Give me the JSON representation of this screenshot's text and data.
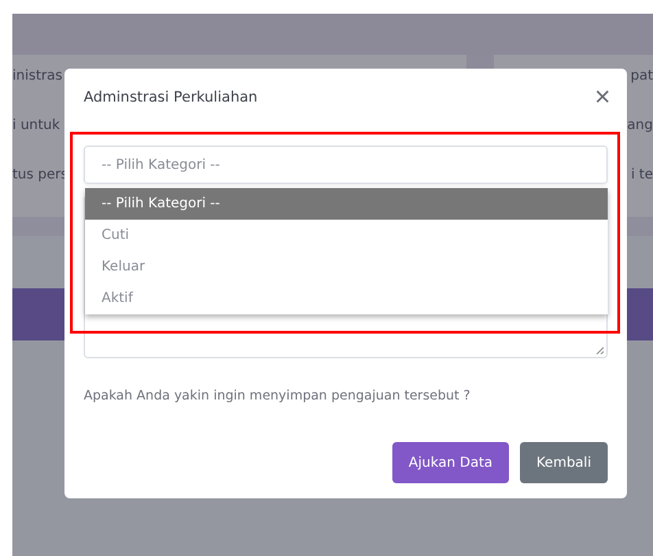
{
  "background": {
    "left_panel": [
      "inistras",
      "i untuk",
      "tus pers"
    ],
    "right_panel": [
      "pat",
      "ang",
      "i te"
    ]
  },
  "modal": {
    "title": "Adminstrasi Perkuliahan",
    "close": "×",
    "select": {
      "placeholder": "-- Pilih Kategori --",
      "expanded": true
    },
    "options": [
      {
        "label": "-- Pilih Kategori --",
        "selected": true
      },
      {
        "label": "Cuti",
        "selected": false
      },
      {
        "label": "Keluar",
        "selected": false
      },
      {
        "label": "Aktif",
        "selected": false
      }
    ],
    "message": "Apakah Anda yakin ingin menyimpan pengajuan tersebut ?",
    "buttons": [
      {
        "kind": "primary",
        "label": "Ajukan Data"
      },
      {
        "kind": "secondary",
        "label": "Kembali"
      }
    ]
  },
  "annotation": {
    "kind": "highlight"
  }
}
